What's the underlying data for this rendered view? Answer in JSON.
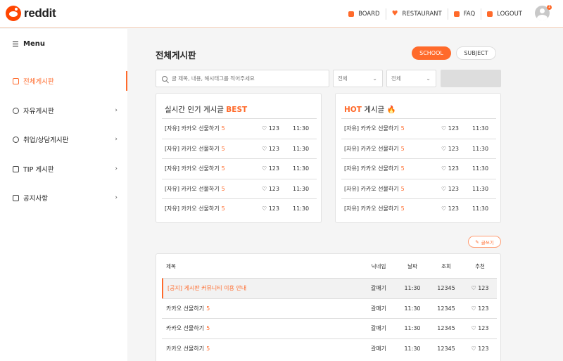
{
  "header": {
    "logo_text": "reddit",
    "nav": [
      {
        "label": "BOARD",
        "icon": "board-icon"
      },
      {
        "label": "RESTAURANT",
        "icon": "heart-icon"
      },
      {
        "label": "FAQ",
        "icon": "chat-icon"
      },
      {
        "label": "LOGOUT",
        "icon": "logout-icon"
      }
    ],
    "notification_count": "1"
  },
  "sidebar": {
    "menu_title": "Menu",
    "items": [
      {
        "label": "전체게시판",
        "active": true
      },
      {
        "label": "자유게시판",
        "chevron": "›"
      },
      {
        "label": "취업/상담게시판",
        "chevron": "›"
      },
      {
        "label": "TIP 게시판",
        "chevron": "›"
      },
      {
        "label": "공지사항",
        "chevron": "›"
      }
    ]
  },
  "main": {
    "title": "전체게시판",
    "toggle": {
      "school": "SCHOOL",
      "subject": "SUBJECT"
    },
    "search": {
      "placeholder": "글 제목, 내용, 해시태그를 적어주세요"
    },
    "selects": [
      "전체",
      "전체"
    ],
    "write_label": "글쓰기"
  },
  "best_card": {
    "title_prefix": "실시간 인기 게시글 ",
    "title_accent": "BEST",
    "rows": [
      {
        "title": "[자유] 카카오 선물하기",
        "count": "5",
        "likes": "♡ 123",
        "time": "11:30"
      },
      {
        "title": "[자유] 카카오 선물하기",
        "count": "5",
        "likes": "♡ 123",
        "time": "11:30"
      },
      {
        "title": "[자유] 카카오 선물하기",
        "count": "5",
        "likes": "♡ 123",
        "time": "11:30"
      },
      {
        "title": "[자유] 카카오 선물하기",
        "count": "5",
        "likes": "♡ 123",
        "time": "11:30"
      },
      {
        "title": "[자유] 카카오 선물하기",
        "count": "5",
        "likes": "♡ 123",
        "time": "11:30"
      }
    ]
  },
  "hot_card": {
    "title_accent": "HOT",
    "title_suffix": " 게시글 🔥",
    "rows": [
      {
        "title": "[자유] 카카오 선물하기",
        "count": "5",
        "likes": "♡ 123",
        "time": "11:30"
      },
      {
        "title": "[자유] 카카오 선물하기",
        "count": "5",
        "likes": "♡ 123",
        "time": "11:30"
      },
      {
        "title": "[자유] 카카오 선물하기",
        "count": "5",
        "likes": "♡ 123",
        "time": "11:30"
      },
      {
        "title": "[자유] 카카오 선물하기",
        "count": "5",
        "likes": "♡ 123",
        "time": "11:30"
      },
      {
        "title": "[자유] 카카오 선물하기",
        "count": "5",
        "likes": "♡ 123",
        "time": "11:30"
      }
    ]
  },
  "board": {
    "columns": [
      "제목",
      "닉네임",
      "날짜",
      "조회",
      "추천"
    ],
    "rows": [
      {
        "title": "[공지] 게시판 커뮤니티 이용 안내",
        "count": "",
        "nickname": "갈매기",
        "date": "11:30",
        "views": "12345",
        "likes": "♡ 123"
      },
      {
        "title": "카카오 선물하기",
        "count": "5",
        "nickname": "갈매기",
        "date": "11:30",
        "views": "12345",
        "likes": "♡ 123"
      },
      {
        "title": "카카오 선물하기",
        "count": "5",
        "nickname": "갈매기",
        "date": "11:30",
        "views": "12345",
        "likes": "♡ 123"
      },
      {
        "title": "카카오 선물하기",
        "count": "5",
        "nickname": "갈매기",
        "date": "11:30",
        "views": "12345",
        "likes": "♡ 123"
      }
    ]
  },
  "colors": {
    "accent": "#ff6a2b",
    "brand": "#ff4500"
  }
}
